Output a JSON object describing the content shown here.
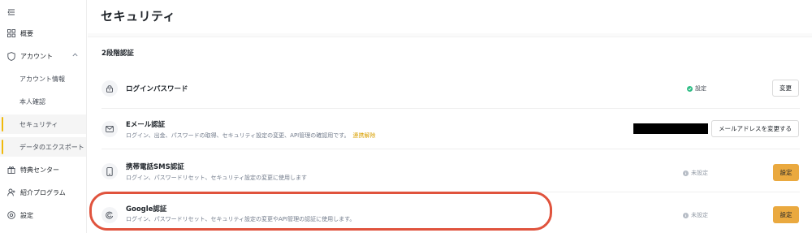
{
  "sidebar": {
    "items": [
      {
        "label": "概要",
        "icon": "grid-icon"
      },
      {
        "label": "アカウント",
        "icon": "shield-icon"
      },
      {
        "label": "アカウント情報"
      },
      {
        "label": "本人確認"
      },
      {
        "label": "セキュリティ"
      },
      {
        "label": "データのエクスポート"
      },
      {
        "label": "特典センター",
        "icon": "gift-icon"
      },
      {
        "label": "紹介プログラム",
        "icon": "user-plus-icon"
      },
      {
        "label": "設定",
        "icon": "settings-icon"
      }
    ]
  },
  "header": {
    "title": "セキュリティ"
  },
  "section": {
    "title": "2段階認証"
  },
  "rows": [
    {
      "title": "ログインパスワード",
      "status": "設定",
      "action": "変更"
    },
    {
      "title": "Eメール認証",
      "description": "ログイン、出金、パスワードの取得、セキュリティ設定の変更、API管理の確認用です。",
      "link": "連携解除",
      "action": "メールアドレスを変更する"
    },
    {
      "title": "携帯電話SMS認証",
      "description": "ログイン、パスワードリセット、セキュリティ設定の変更に使用します",
      "status": "未設定",
      "action": "設定"
    },
    {
      "title": "Google認証",
      "description": "ログイン、パスワードリセット、セキュリティ設定の変更やAPI管理の認証に使用します。",
      "status": "未設定",
      "action": "設定"
    }
  ],
  "colors": {
    "accent": "#eaa93f",
    "highlight": "#e0533d",
    "success": "#2ebd85"
  }
}
